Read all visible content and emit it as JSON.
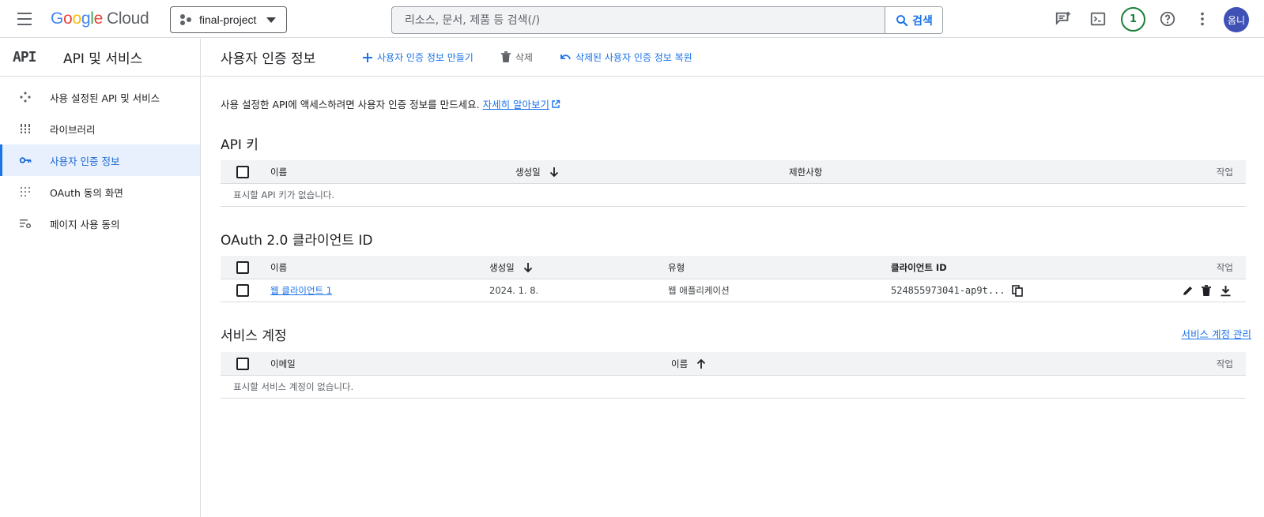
{
  "topbar": {
    "logo_google": [
      "G",
      "o",
      "o",
      "g",
      "l",
      "e"
    ],
    "logo_cloud": "Cloud",
    "project_name": "final-project",
    "search_placeholder": "리소스, 문서, 제품 등 검색(/)",
    "search_button": "검색",
    "notification_count": "1",
    "avatar_text": "옴니"
  },
  "sidebar": {
    "logo": "API",
    "title": "API 및 서비스",
    "items": [
      {
        "label": "사용 설정된 API 및 서비스",
        "icon": "hub-icon"
      },
      {
        "label": "라이브러리",
        "icon": "library-icon"
      },
      {
        "label": "사용자 인증 정보",
        "icon": "key-icon",
        "active": true
      },
      {
        "label": "OAuth 동의 화면",
        "icon": "dots-grid-icon"
      },
      {
        "label": "페이지 사용 동의",
        "icon": "list-settings-icon"
      }
    ]
  },
  "actionbar": {
    "title": "사용자 인증 정보",
    "create": "사용자 인증 정보 만들기",
    "delete": "삭제",
    "restore": "삭제된 사용자 인증 정보 복원"
  },
  "intro": {
    "text": "사용 설정한 API에 액세스하려면 사용자 인증 정보를 만드세요.",
    "link": "자세히 알아보기"
  },
  "api_keys": {
    "title": "API 키",
    "columns": {
      "name": "이름",
      "created": "생성일",
      "restrictions": "제한사항",
      "actions": "작업"
    },
    "empty": "표시할 API 키가 없습니다."
  },
  "oauth": {
    "title": "OAuth 2.0 클라이언트 ID",
    "columns": {
      "name": "이름",
      "created": "생성일",
      "type": "유형",
      "client_id": "클라이언트 ID",
      "actions": "작업"
    },
    "rows": [
      {
        "name": "웹 클라이언트 1",
        "created": "2024. 1. 8.",
        "type": "웹 애플리케이션",
        "client_id": "524855973041-ap9t..."
      }
    ]
  },
  "service_accounts": {
    "title": "서비스 계정",
    "manage": "서비스 계정 관리",
    "columns": {
      "email": "이메일",
      "name": "이름",
      "actions": "작업"
    },
    "empty": "표시할 서비스 계정이 없습니다."
  },
  "colors": {
    "accent": "#1a73e8",
    "active_bg": "#e8f0fe",
    "badge": "#188038",
    "avatar": "#3f51b5"
  }
}
